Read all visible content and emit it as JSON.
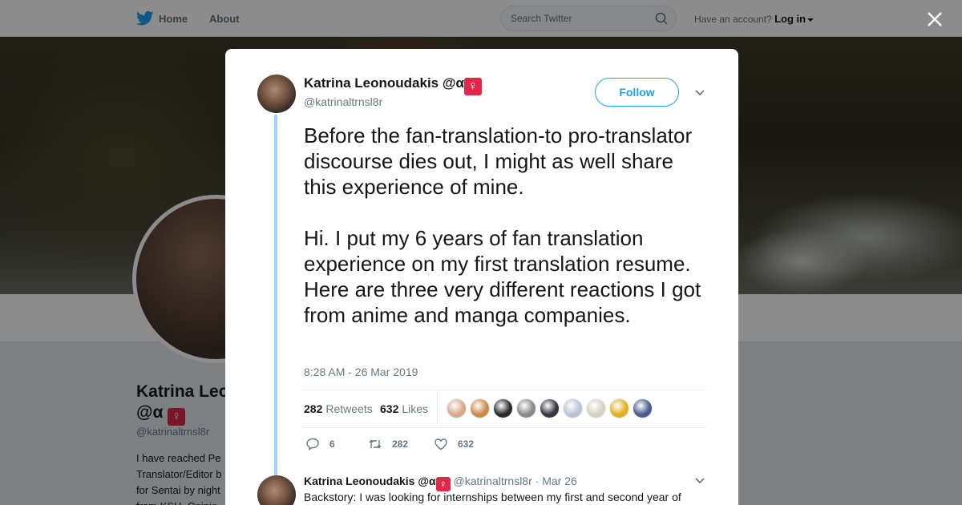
{
  "colors": {
    "brand": "#1da1f2",
    "accent_badge": "#e0284a",
    "thread_line": "#a3d4f2"
  },
  "topbar": {
    "home_label": "Home",
    "about_label": "About",
    "search": {
      "placeholder": "Search Twitter",
      "value": ""
    },
    "account_prompt": "Have an account?",
    "login_label": "Log in"
  },
  "background_profile": {
    "name_line1": "Katrina Leonoudakis",
    "name_line2": "@α",
    "badge": "♀",
    "handle": "@katrinaltrnsl8r",
    "bio_lines": [
      "I have reached Pe",
      "Translator/Editor b",
      "for Sentai by night",
      "from KSU. Opinio"
    ]
  },
  "tweet": {
    "author_name": "Katrina Leonoudakis @α",
    "badge": "♀",
    "handle": "@katrinaltrnsl8r",
    "follow_label": "Follow",
    "text_paragraphs": [
      "Before the fan-translation-to pro-translator discourse dies out, I might as well share this experience of mine.",
      "Hi. I put my 6 years of fan translation experience on my first translation resume. Here are three very different reactions I got from anime and manga companies."
    ],
    "timestamp": "8:28 AM - 26 Mar 2019",
    "retweets_count": "282",
    "retweets_label": "Retweets",
    "likes_count": "632",
    "likes_label": "Likes",
    "liker_avatar_colors": [
      "#d9a88a",
      "#c98a4a",
      "#2b2b2b",
      "#8a8a8a",
      "#3a3340",
      "#b8c4d4",
      "#d4d0c2",
      "#e0b020",
      "#4a5a8a"
    ],
    "actions": {
      "replies": "6",
      "retweets": "282",
      "likes": "632"
    }
  },
  "reply": {
    "author_name": "Katrina Leonoudakis @α",
    "badge": "♀",
    "handle": "@katrinaltrnsl8r",
    "separator": "·",
    "date": "Mar 26",
    "text": "Backstory: I was looking for internships between my first and second year of"
  }
}
